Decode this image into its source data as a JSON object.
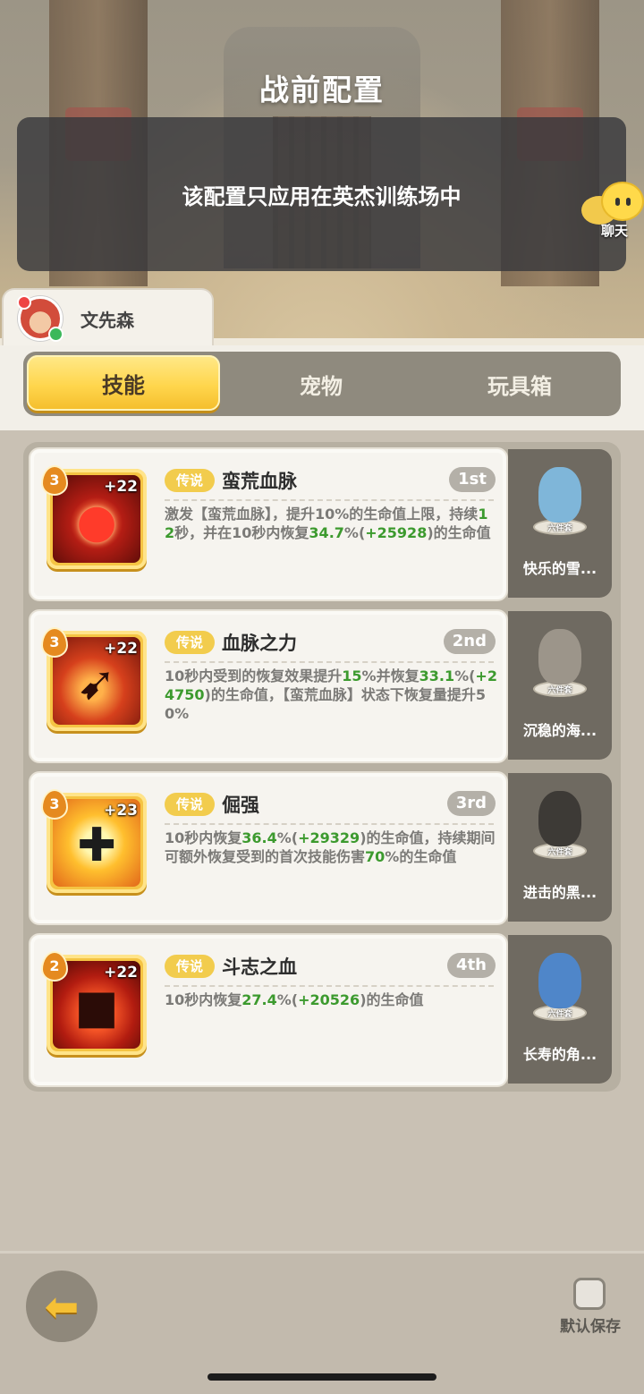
{
  "header": {
    "title": "战前配置",
    "notice": "该配置只应用在英杰训练场中",
    "chat_label": "聊天"
  },
  "player": {
    "name": "文先森"
  },
  "tabs": [
    {
      "label": "技能",
      "active": true
    },
    {
      "label": "宠物",
      "active": false
    },
    {
      "label": "玩具箱",
      "active": false
    }
  ],
  "skills": [
    {
      "level": "3",
      "bonus": "+22",
      "rarity": "传说",
      "name": "蛮荒血脉",
      "rank": "1st",
      "icon": "blood-drop-icon",
      "desc": [
        "激发【蛮荒血脉】，提升10%的生命值上限，持续",
        "12",
        "秒，并在10秒内恢复",
        "34.7",
        "%(",
        "+25928",
        ")的生命值"
      ],
      "pet": {
        "name": "快乐的雪...",
        "set": "六件套",
        "color": "#7fb6d9"
      }
    },
    {
      "level": "3",
      "bonus": "+22",
      "rarity": "传说",
      "name": "血脉之力",
      "rank": "2nd",
      "icon": "blood-blade-icon",
      "desc": [
        "10秒内受到的恢复效果提升",
        "15",
        "%并恢复",
        "33.1",
        "%(",
        "+24750",
        ")的生命值，【蛮荒血脉】状态下恢复量提升50%"
      ],
      "pet": {
        "name": "沉稳的海...",
        "set": "六件套",
        "color": "#7a746c"
      }
    },
    {
      "level": "3",
      "bonus": "+23",
      "rarity": "传说",
      "name": "倔强",
      "rank": "3rd",
      "icon": "stubborn-figure-icon",
      "desc": [
        "10秒内恢复",
        "36.4",
        "%(",
        "+29329",
        ")的生命值，持续期间可额外恢复受到的首次技能伤害",
        "70",
        "%的生命值"
      ],
      "pet": {
        "name": "进击的黑...",
        "set": "六件套",
        "color": "#3d3a36"
      }
    },
    {
      "level": "2",
      "bonus": "+22",
      "rarity": "传说",
      "name": "斗志之血",
      "rank": "4th",
      "icon": "angry-face-icon",
      "desc": [
        "10秒内恢复",
        "27.4",
        "%(",
        "+20526",
        ")的生命值"
      ],
      "pet": {
        "name": "长寿的角...",
        "set": "六件套",
        "color": "#4f86c9"
      }
    }
  ],
  "footer": {
    "save_label": "默认保存",
    "save_checked": false
  },
  "colors": {
    "accent_yellow": "#ffd64d",
    "highlight_green": "#3c9a2e"
  }
}
